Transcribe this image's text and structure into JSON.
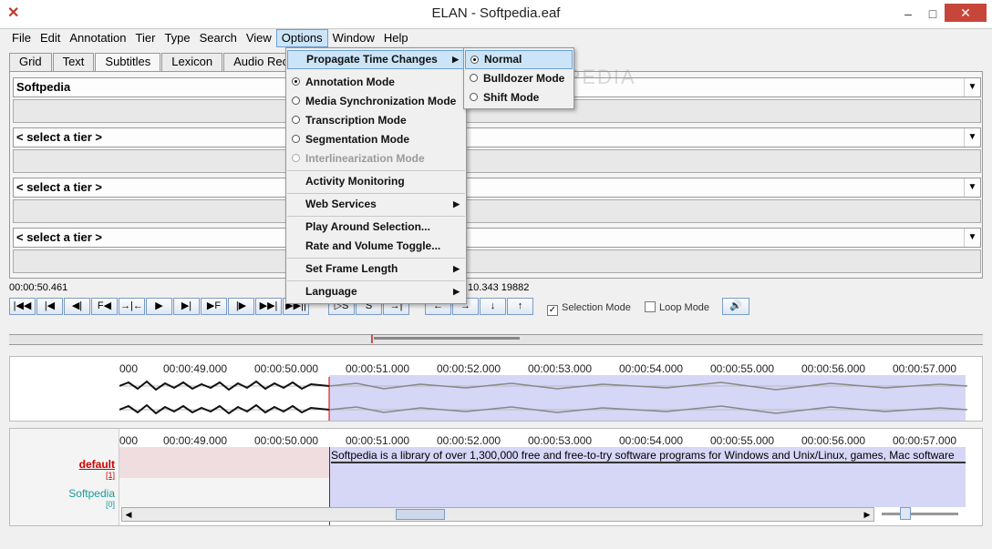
{
  "window": {
    "title": "ELAN - Softpedia.eaf"
  },
  "menubar": [
    "File",
    "Edit",
    "Annotation",
    "Tier",
    "Type",
    "Search",
    "View",
    "Options",
    "Window",
    "Help"
  ],
  "tabs": [
    "Grid",
    "Text",
    "Subtitles",
    "Lexicon",
    "Audio Reco"
  ],
  "subtitle_panel": {
    "tiers": [
      "Softpedia",
      "< select a tier >",
      "< select a tier >",
      "< select a tier >"
    ]
  },
  "media": {
    "current_time": "00:00:50.461",
    "selection_info": ":10.343  19882",
    "selection_mode_label": "Selection Mode",
    "loop_mode_label": "Loop Mode",
    "selection_mode_checked": true,
    "loop_mode_checked": false
  },
  "controls": {
    "buttons": [
      "|◀◀",
      "|◀",
      "◀|",
      "F◀",
      "→|←",
      "▶",
      "▶|",
      "▶F",
      "|▶",
      "▶▶|",
      "▶▶||"
    ],
    "sel_buttons": [
      "▷S",
      "S",
      "→|"
    ],
    "nav_buttons": [
      "←",
      "→",
      "↓",
      "↑"
    ]
  },
  "ruler": {
    "ticks": [
      "000",
      "00:00:49.000",
      "00:00:50.000",
      "00:00:51.000",
      "00:00:52.000",
      "00:00:53.000",
      "00:00:54.000",
      "00:00:55.000",
      "00:00:56.000",
      "00:00:57.000"
    ]
  },
  "tiers": [
    {
      "name": "default",
      "count": "[1]",
      "color": "#cc0000"
    },
    {
      "name": "Softpedia",
      "count": "[0]",
      "color": "#1a9a9a"
    }
  ],
  "annotation_text": "Softpedia is a library of over 1,300,000 free and free-to-try software programs for Windows and Unix/Linux, games, Mac software",
  "options_menu": {
    "items": [
      "Propagate Time Changes",
      "Annotation Mode",
      "Media Synchronization Mode",
      "Transcription Mode",
      "Segmentation Mode",
      "Interlinearization Mode",
      "Activity Monitoring",
      "Web Services",
      "Play Around Selection...",
      "Rate and Volume Toggle...",
      "Set Frame Length",
      "Language"
    ]
  },
  "propagate_submenu": {
    "items": [
      "Normal",
      "Bulldozer Mode",
      "Shift Mode"
    ]
  },
  "watermark": "SOFTPEDIA"
}
